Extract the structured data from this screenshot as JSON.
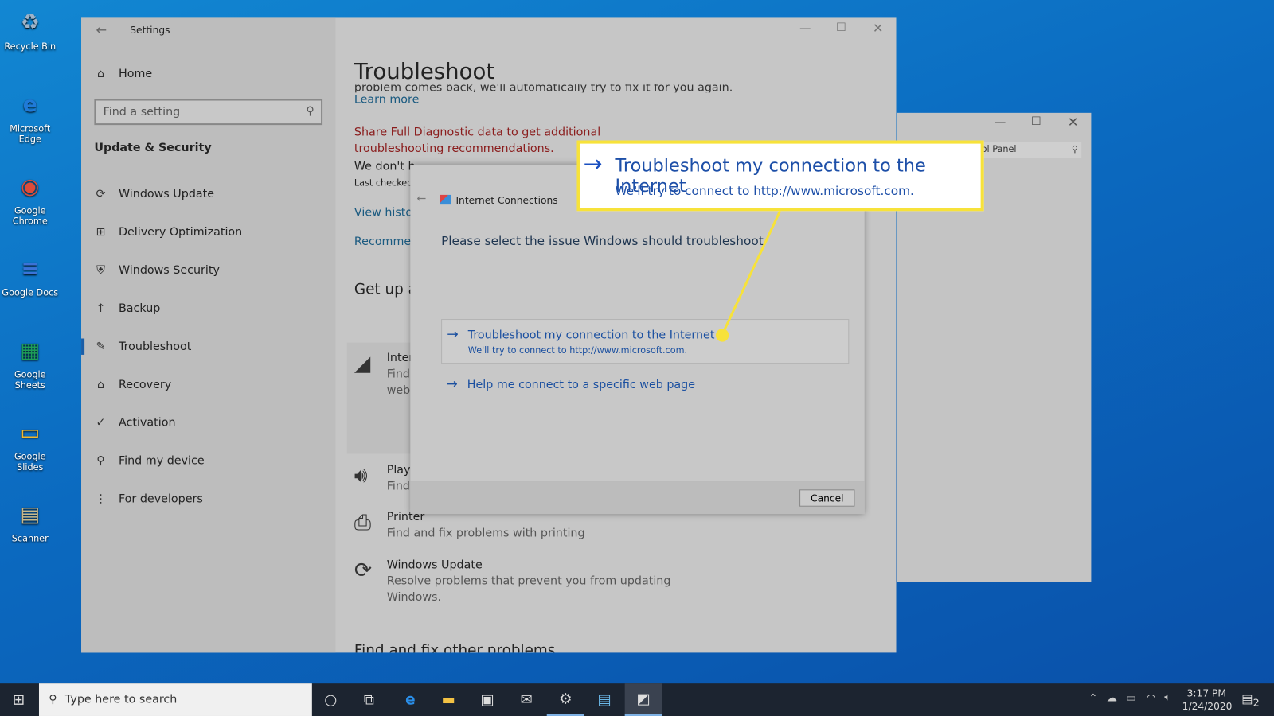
{
  "desktop": {
    "icons": [
      {
        "label": "Recycle Bin",
        "glyph": "♻",
        "color": "#9fb3c8"
      },
      {
        "label": "Microsoft Edge",
        "glyph": "e",
        "color": "#1f7ad8"
      },
      {
        "label": "Google Chrome",
        "glyph": "◉",
        "color": "#dd4b39"
      },
      {
        "label": "Google Docs",
        "glyph": "≡",
        "color": "#3b73d8"
      },
      {
        "label": "Google Sheets",
        "glyph": "▦",
        "color": "#1e9e57"
      },
      {
        "label": "Google Slides",
        "glyph": "▭",
        "color": "#f1b82c"
      },
      {
        "label": "Scanner",
        "glyph": "▤",
        "color": "#c8b98a"
      }
    ]
  },
  "settings": {
    "title": "Settings",
    "home": "Home",
    "search_placeholder": "Find a setting",
    "section": "Update & Security",
    "nav": [
      {
        "label": "Windows Update",
        "icon": "⟳"
      },
      {
        "label": "Delivery Optimization",
        "icon": "⊞"
      },
      {
        "label": "Windows Security",
        "icon": "⛨"
      },
      {
        "label": "Backup",
        "icon": "↑"
      },
      {
        "label": "Troubleshoot",
        "icon": "✎",
        "active": true
      },
      {
        "label": "Recovery",
        "icon": "⌂"
      },
      {
        "label": "Activation",
        "icon": "✓"
      },
      {
        "label": "Find my device",
        "icon": "⚲"
      },
      {
        "label": "For developers",
        "icon": "⋮"
      }
    ],
    "main": {
      "title": "Troubleshoot",
      "cut_text": "problem comes back, we'll automatically try to fix it for you again.",
      "learn_more": "Learn more",
      "diag": "Share Full Diagnostic data to get additional troubleshooting recommendations.",
      "we_dont": "We don't h",
      "last_checked": "Last checked:",
      "view_history": "View histo",
      "recommended": "Recommen",
      "get_up": "Get up a",
      "items": [
        {
          "title": "Inter",
          "desc": "Find",
          "desc2": "webs",
          "icon": "wifi-icon"
        },
        {
          "title": "Playi",
          "desc": "Find",
          "icon": "speaker-icon"
        },
        {
          "title": "Printer",
          "desc": "Find and fix problems with printing",
          "icon": "printer-icon"
        },
        {
          "title": "Windows Update",
          "desc": "Resolve problems that prevent you from updating",
          "desc2": "Windows.",
          "icon": "refresh-icon"
        }
      ],
      "find_fix": "Find and fix other problems"
    }
  },
  "dialog": {
    "title": "Internet Connections",
    "prompt": "Please select the issue Windows should troubleshoot",
    "option1": {
      "title": "Troubleshoot my connection to the Internet",
      "desc": "We'll try to connect to http://www.microsoft.com."
    },
    "option2": {
      "title": "Help me connect to a specific web page"
    },
    "cancel": "Cancel"
  },
  "callout": {
    "title": "Troubleshoot my connection to the Internet",
    "desc": "We'll try to connect to http://www.microsoft.com.",
    "color": "#f7e23a"
  },
  "bgwindow": {
    "search_text": "ol Panel"
  },
  "taskbar": {
    "search_placeholder": "Type here to search",
    "time": "3:17 PM",
    "date": "1/24/2020",
    "notifications": "2"
  }
}
